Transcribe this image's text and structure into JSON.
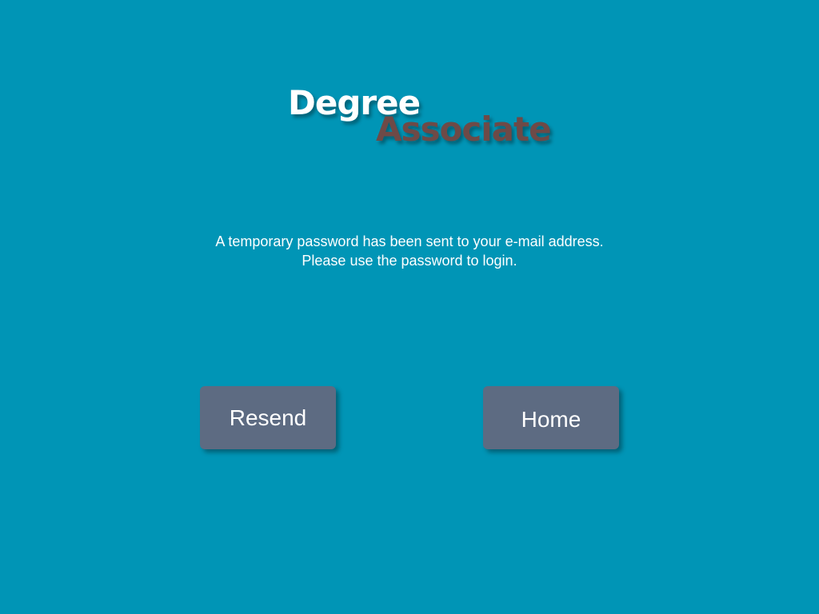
{
  "logo": {
    "word1": "Degree",
    "word2": "Associate"
  },
  "message": {
    "line1": "A temporary password has been sent to your e-mail address.",
    "line2": "Please use the password to login."
  },
  "buttons": {
    "resend_label": "Resend",
    "home_label": "Home"
  },
  "colors": {
    "background": "#0095b6",
    "button": "#5d6b82",
    "logo_primary": "#ffffff",
    "logo_secondary": "#6e4a47"
  }
}
